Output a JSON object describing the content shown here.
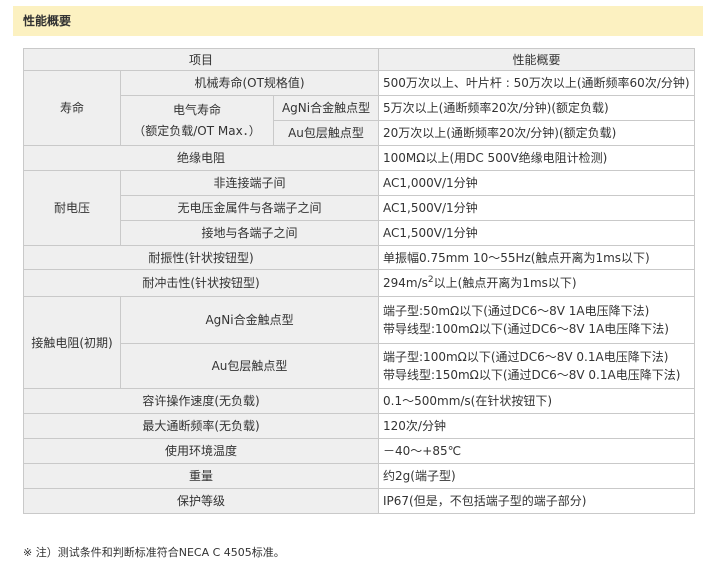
{
  "section_title": "性能概要",
  "table": {
    "head_item": "项目",
    "head_value": "性能概要",
    "life": {
      "group": "寿命",
      "mech_label": "机械寿命(OT规格值)",
      "mech_value": "500万次以上、叶片杆 : 50万次以上(通断频率60次/分钟)",
      "elec_label_1": "电气寿命",
      "elec_label_2": "（额定负载/OT Max．）",
      "agni_label": "AgNi合金触点型",
      "agni_value": "5万次以上(通断频率20次/分钟)(额定负载)",
      "au_label": "Au包层触点型",
      "au_value": "20万次以上(通断频率20次/分钟)(额定负载)"
    },
    "insulation": {
      "label": "绝缘电阻",
      "value": "100MΩ以上(用DC 500V绝缘电阻计检测)"
    },
    "withstand": {
      "group": "耐电压",
      "rows": [
        {
          "label": "非连接端子间",
          "value": "AC1,000V/1分钟"
        },
        {
          "label": "无电压金属件与各端子之间",
          "value": "AC1,500V/1分钟"
        },
        {
          "label": "接地与各端子之间",
          "value": "AC1,500V/1分钟"
        }
      ]
    },
    "vibration": {
      "label": "耐振性(针状按钮型)",
      "value": "单振幅0.75mm 10～55Hz(触点开离为1ms以下)"
    },
    "shock": {
      "label": "耐冲击性(针状按钮型)",
      "value_prefix": "294m/s",
      "value_sup": "2",
      "value_suffix": "以上(触点开离为1ms以下)"
    },
    "contact": {
      "group": "接触电阻(初期)",
      "agni_label": "AgNi合金触点型",
      "agni_line1": "端子型:50mΩ以下(通过DC6～8V 1A电压降下法)",
      "agni_line2": "带导线型:100mΩ以下(通过DC6～8V 1A电压降下法)",
      "au_label": "Au包层触点型",
      "au_line1": "端子型:100mΩ以下(通过DC6～8V 0.1A电压降下法)",
      "au_line2": "带导线型:150mΩ以下(通过DC6～8V 0.1A电压降下法)"
    },
    "speed": {
      "label": "容许操作速度(无负载)",
      "value": "0.1～500mm/s(在针状按钮下)"
    },
    "frequency": {
      "label": "最大通断频率(无负载)",
      "value": "120次/分钟"
    },
    "temperature": {
      "label": "使用环境温度",
      "value": "－40～+85℃"
    },
    "weight": {
      "label": "重量",
      "value": "约2g(端子型)"
    },
    "protection": {
      "label": "保护等级",
      "value": "IP67(但是，不包括端子型的端子部分)"
    }
  },
  "note": "※ 注）测试条件和判断标准符合NECA C 4505标准。"
}
